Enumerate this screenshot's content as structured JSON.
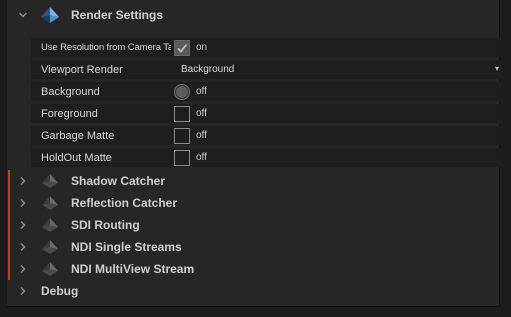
{
  "render_settings": {
    "title": "Render Settings",
    "rows": [
      {
        "label": "Use Resolution from Camera Ta...",
        "state": "on"
      },
      {
        "label": "Viewport Render",
        "value": "Background"
      },
      {
        "label": "Background",
        "state": "off"
      },
      {
        "label": "Foreground",
        "state": "off"
      },
      {
        "label": "Garbage Matte",
        "state": "off"
      },
      {
        "label": "HoldOut Matte",
        "state": "off"
      }
    ]
  },
  "sections": [
    {
      "title": "Shadow Catcher"
    },
    {
      "title": "Reflection Catcher"
    },
    {
      "title": "SDI Routing"
    },
    {
      "title": "NDI Single Streams"
    },
    {
      "title": "NDI MultiView Stream"
    },
    {
      "title": "Debug"
    }
  ],
  "colors": {
    "accent": "#c0431e",
    "logo_blue": "#5aa8e8"
  }
}
